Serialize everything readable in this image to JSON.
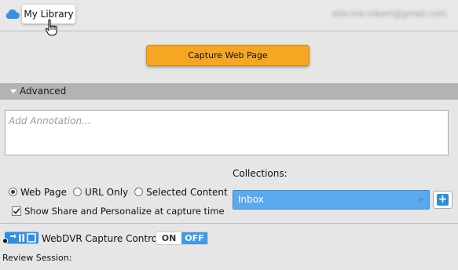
{
  "header": {
    "library_label": "My Library",
    "user_email": "ella.ma.robert@gmail.com"
  },
  "capture": {
    "button_label": "Capture Web Page"
  },
  "advanced": {
    "label": "Advanced"
  },
  "annotation": {
    "placeholder": "Add Annotation...",
    "value": ""
  },
  "capture_mode": {
    "options": [
      {
        "label": "Web Page",
        "selected": true
      },
      {
        "label": "URL Only",
        "selected": false
      },
      {
        "label": "Selected Content",
        "selected": false
      }
    ],
    "share_checkbox_label": "Show Share and Personalize at capture time",
    "share_checked": true
  },
  "collections": {
    "label": "Collections:",
    "selected": "Inbox",
    "add_label": "+"
  },
  "webdvr": {
    "label": "WebDVR Capture Control",
    "on_label": "ON",
    "off_label": "OFF",
    "state": "off"
  },
  "review": {
    "label": "Review Session:"
  },
  "colors": {
    "accent_orange": "#f5a623",
    "select_blue": "#5aa9ee",
    "toggle_blue": "#3d9be9",
    "cloud_blue": "#3a8fe0"
  },
  "icons": [
    "cloud-icon",
    "hand-cursor-icon",
    "chevron-down-icon",
    "plus-icon",
    "webdvr-icon"
  ]
}
